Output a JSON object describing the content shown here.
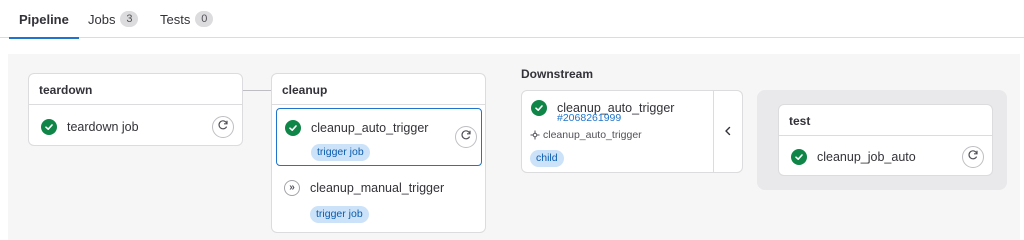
{
  "tabs": [
    {
      "label": "Pipeline",
      "active": true
    },
    {
      "label": "Jobs",
      "count": "3"
    },
    {
      "label": "Tests",
      "count": "0"
    }
  ],
  "stages": {
    "teardown": {
      "title": "teardown",
      "jobs": [
        {
          "name": "teardown job",
          "status": "success",
          "action": "retry-icon"
        }
      ]
    },
    "cleanup": {
      "title": "cleanup",
      "jobs": [
        {
          "name": "cleanup_auto_trigger",
          "status": "success",
          "badge": "trigger job",
          "action": "retry-icon"
        },
        {
          "name": "cleanup_manual_trigger",
          "status": "manual",
          "badge": "trigger job"
        }
      ]
    },
    "test": {
      "title": "test",
      "jobs": [
        {
          "name": "cleanup_job_auto",
          "status": "success",
          "action": "retry-icon"
        }
      ]
    }
  },
  "downstream": {
    "label": "Downstream",
    "pipeline": {
      "name": "cleanup_auto_trigger",
      "id": "#2068261999",
      "source_job": "cleanup_auto_trigger",
      "badge": "child",
      "status": "success"
    },
    "collapse_icon": "chevron-left-icon"
  },
  "colors": {
    "success": "#108548",
    "accent": "#1f75cb",
    "badge_bg": "#cbe2f9"
  }
}
